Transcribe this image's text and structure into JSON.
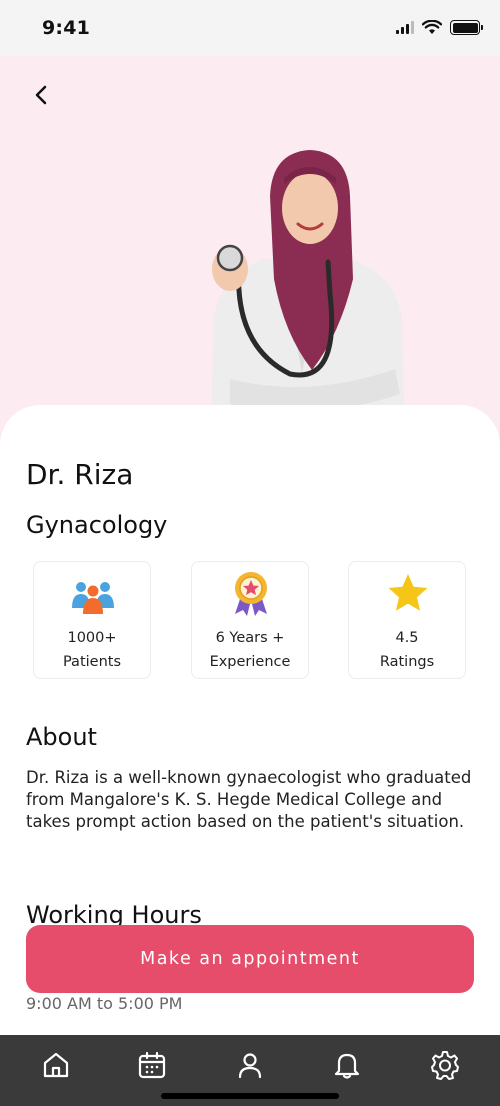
{
  "status": {
    "time": "9:41"
  },
  "doctor": {
    "name": "Dr. Riza",
    "specialty": "Gynacology"
  },
  "stats": [
    {
      "icon": "patients-icon",
      "line1": "1000+",
      "line2": "Patients"
    },
    {
      "icon": "award-badge-icon",
      "line1": "6 Years +",
      "line2": "Experience"
    },
    {
      "icon": "star-icon",
      "line1": "4.5",
      "line2": "Ratings"
    }
  ],
  "about": {
    "title": "About",
    "text": "Dr. Riza is a well-known gynaecologist who graduated from Mangalore's K. S. Hegde Medical College and takes prompt action based on the patient's situation."
  },
  "working_hours": {
    "title": "Working Hours",
    "value": "9:00 AM to 5:00 PM"
  },
  "cta": {
    "label": "Make an appointment"
  },
  "nav": [
    "home-icon",
    "calendar-icon",
    "profile-icon",
    "bell-icon",
    "settings-icon"
  ],
  "colors": {
    "accent": "#e54d6b",
    "hero_bg": "#fcebf0",
    "nav_bg": "#3a3a3a"
  }
}
